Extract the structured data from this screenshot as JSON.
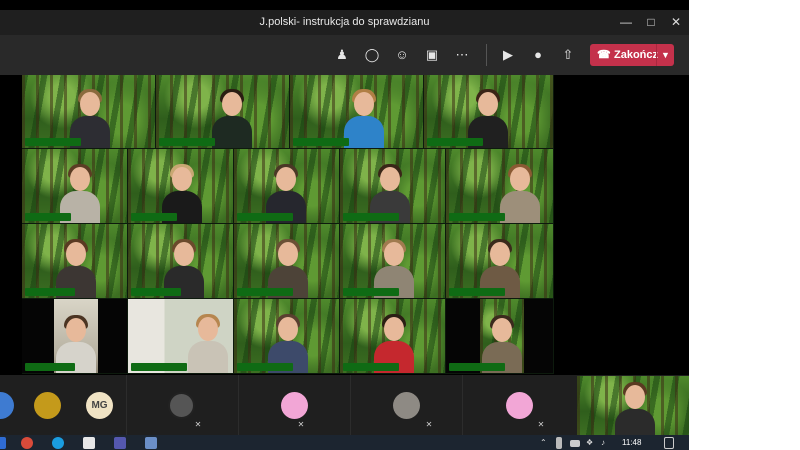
{
  "window": {
    "title": "J.polski- instrukcja do sprawdzianu",
    "minimize_icon": "minimize-icon",
    "maximize_icon": "maximize-icon",
    "close_icon": "close-icon"
  },
  "toolbar": {
    "icons": [
      "participants-icon",
      "chat-icon",
      "reactions-icon",
      "rooms-icon",
      "more-icon",
      "camera-icon",
      "mic-icon",
      "share-icon"
    ],
    "end_call_label": "Zakończ",
    "end_call_color": "#c4314b"
  },
  "tray": {
    "avatars": [
      {
        "initials": "",
        "name": "avatar-photo"
      },
      {
        "initials": "",
        "name": "avatar-logo"
      },
      {
        "initials": "MG",
        "name": "avatar-initials"
      },
      {
        "initials": "",
        "name": "avatar-photo"
      },
      {
        "initials": "",
        "name": "avatar-emoji"
      },
      {
        "initials": "",
        "name": "avatar-photo"
      },
      {
        "initials": "",
        "name": "avatar-emoji"
      }
    ]
  },
  "taskbar": {
    "time": "11:48"
  },
  "colors": {
    "accent_green": "#0f6b14",
    "end_call": "#c4314b",
    "window_bg": "#1f1f1f"
  }
}
